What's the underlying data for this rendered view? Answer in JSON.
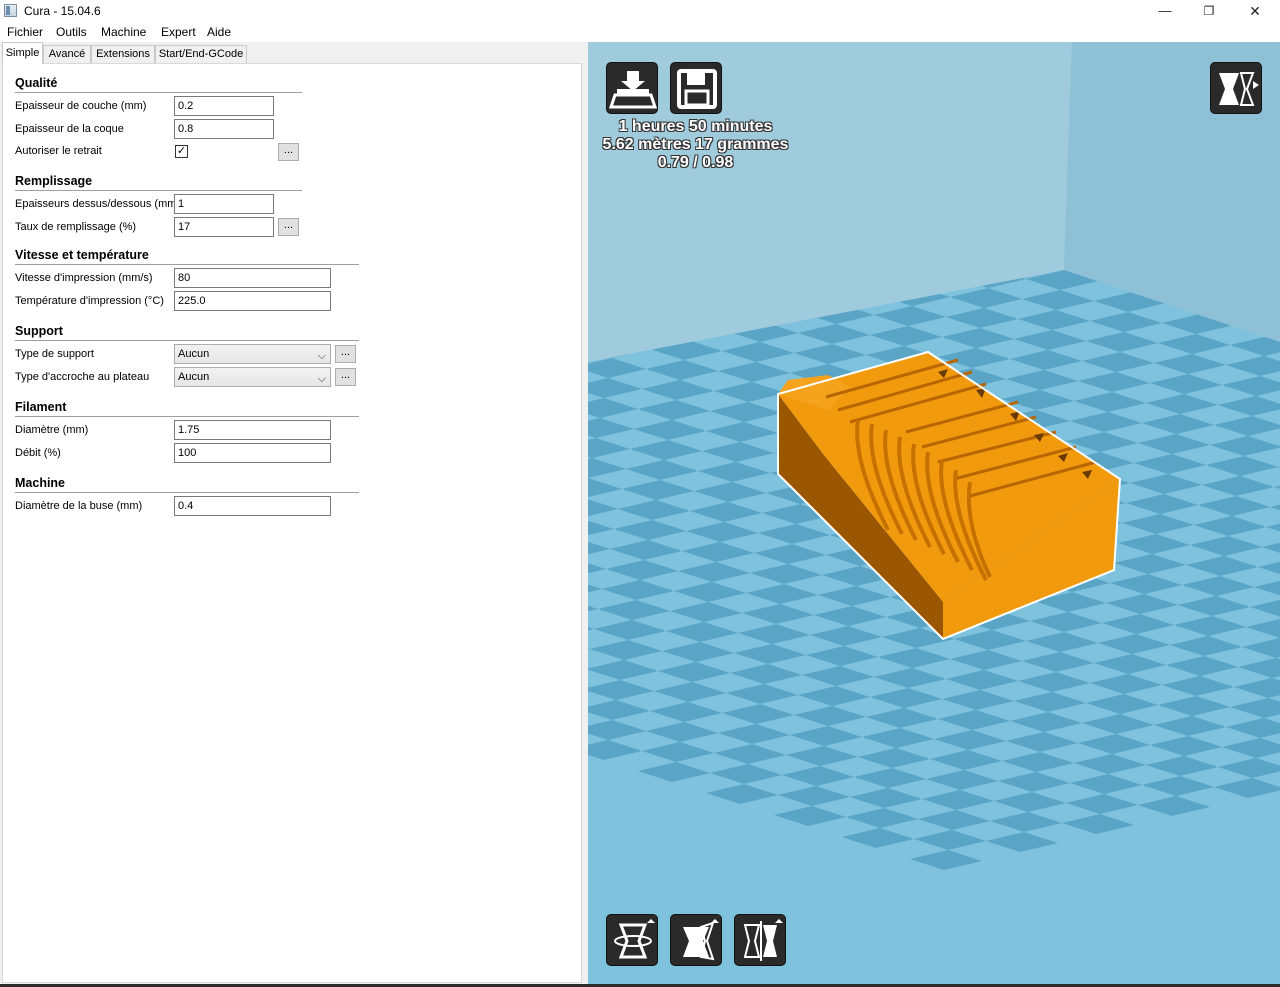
{
  "window": {
    "title": "Cura - 15.04.6",
    "minimize": "—",
    "maximize": "❐",
    "close": "✕"
  },
  "menu": [
    "Fichier",
    "Outils",
    "Machine",
    "Expert",
    "Aide"
  ],
  "tabs": [
    "Simple",
    "Avancé",
    "Extensions",
    "Start/End-GCode"
  ],
  "sections": {
    "quality": {
      "title": "Qualité",
      "layer_height": {
        "label": "Epaisseur de couche (mm)",
        "value": "0.2"
      },
      "shell_thickness": {
        "label": "Epaisseur de la coque",
        "value": "0.8"
      },
      "retraction": {
        "label": "Autoriser le retrait",
        "checked": "✓"
      }
    },
    "fill": {
      "title": "Remplissage",
      "bottom_top": {
        "label": "Epaisseurs dessus/dessous (mm)",
        "value": "1"
      },
      "density": {
        "label": "Taux de remplissage (%)",
        "value": "17"
      }
    },
    "speed": {
      "title": "Vitesse et température",
      "print_speed": {
        "label": "Vitesse d'impression (mm/s)",
        "value": "80"
      },
      "temperature": {
        "label": "Température d'impression (°C)",
        "value": "225.0"
      }
    },
    "support": {
      "title": "Support",
      "support_type": {
        "label": "Type de support",
        "value": "Aucun"
      },
      "adhesion": {
        "label": "Type d'accroche au plateau",
        "value": "Aucun"
      }
    },
    "filament": {
      "title": "Filament",
      "diameter": {
        "label": "Diamètre (mm)",
        "value": "1.75"
      },
      "flow": {
        "label": "Débit (%)",
        "value": "100"
      }
    },
    "machine": {
      "title": "Machine",
      "nozzle": {
        "label": "Diamètre de la buse (mm)",
        "value": "0.4"
      }
    }
  },
  "dots_label": "...",
  "chevron": "⌵",
  "viewport": {
    "print_time": "1 heures 50 minutes",
    "material": "5.62 mètres 17 grammes",
    "cost": "0.79 / 0.98",
    "colors": {
      "bed_light": "#7ec2de",
      "bed_dark": "#5aa4c6",
      "wall": "#a3cfe0",
      "model": "#f29a0e",
      "model_shade": "#a85f00"
    }
  },
  "icons": {
    "load": "load-model-icon",
    "save": "save-gcode-icon",
    "view_mode": "view-mode-icon",
    "rotate": "rotate-icon",
    "scale": "scale-icon",
    "mirror": "mirror-icon"
  }
}
